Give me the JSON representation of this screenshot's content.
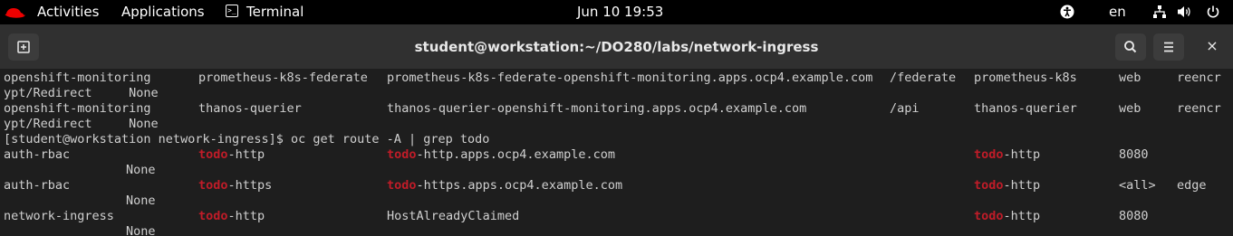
{
  "topbar": {
    "activities": "Activities",
    "applications": "Applications",
    "terminal": "Terminal",
    "datetime": "Jun 10  19:53",
    "language": "en"
  },
  "window": {
    "title": "student@workstation:~/DO280/labs/network-ingress",
    "close": "×"
  },
  "terminal": {
    "highlight_color": "#c01c28",
    "rows": [
      {
        "ns": "openshift-monitoring",
        "name": "prometheus-k8s-federate",
        "host": "prometheus-k8s-federate-openshift-monitoring.apps.ocp4.example.com",
        "path": "/federate",
        "svc": "prometheus-k8s",
        "port": "web",
        "term": "reencr",
        "wrap": "ypt/Redirect     None"
      },
      {
        "ns": "openshift-monitoring",
        "name": "thanos-querier",
        "host": "thanos-querier-openshift-monitoring.apps.ocp4.example.com",
        "path": "/api",
        "svc": "thanos-querier",
        "port": "web",
        "term": "reencr",
        "wrap": "ypt/Redirect     None"
      }
    ],
    "command": "[student@workstation network-ingress]$ oc get route -A | grep todo",
    "grep_match": "todo",
    "todo_rows": [
      {
        "ns": "auth-rbac",
        "name_rest": "-http",
        "host": "-http.apps.ocp4.example.com",
        "svc_rest": "-http",
        "port": "8080",
        "term": "",
        "wrap": "None"
      },
      {
        "ns": "auth-rbac",
        "name_rest": "-https",
        "host": "-https.apps.ocp4.example.com",
        "svc_rest": "-http",
        "port": "<all>",
        "term": "edge",
        "wrap": "None"
      },
      {
        "ns": "network-ingress",
        "name_rest": "-http",
        "host": "HostAlreadyClaimed",
        "svc_rest": "-http",
        "port": "8080",
        "term": "",
        "wrap": "None"
      }
    ]
  }
}
